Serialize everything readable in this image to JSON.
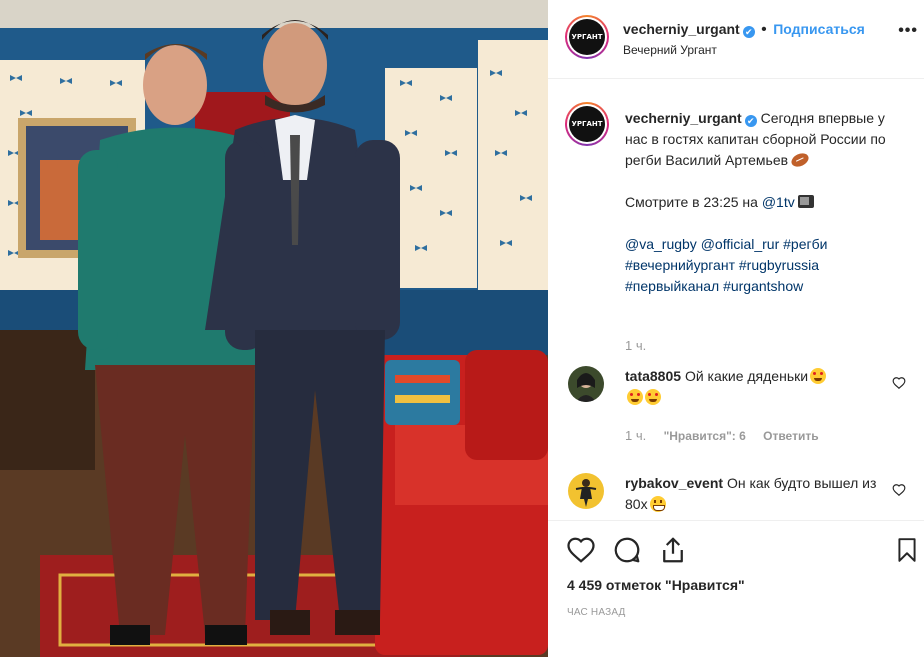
{
  "post": {
    "account": {
      "username": "vecherniy_urgant",
      "display_name": "Вечерний Ургант",
      "follow_label": "Подписаться",
      "avatar_text": "УРГАНТ",
      "verified_mark": "✔"
    },
    "caption": {
      "username": "vecherniy_urgant",
      "text": "Сегодня впервые у нас в гостях капитан сборной России по регби Василий Артемьев",
      "emoji_icon": "rugby-ball-icon",
      "watch_prefix": "Смотрите в 23:25 на ",
      "watch_mention": "@1tv",
      "watch_icon": "tv-icon",
      "tags": [
        "@va_rugby",
        "@official_rur",
        "#регби",
        "#вечернийургант",
        "#rugbyrussia",
        "#первыйканал",
        "#urgantshow"
      ],
      "time": "1 ч."
    },
    "comments": [
      {
        "username": "tata8805",
        "text": "Ой какие дяденьки",
        "emoji_icon": "star-struck-emoji",
        "time": "1 ч.",
        "likes": "\"Нравится\": 6",
        "reply": "Ответить"
      },
      {
        "username": "rybakov_event",
        "text": "Он как будто вышел из 80х",
        "emoji_icon": "grinning-emoji"
      }
    ],
    "likes_text": "4 459 отметок \"Нравится\"",
    "posted_ago": "ЧАС НАЗАД",
    "more_icon": "•••"
  },
  "colors": {
    "accent": "#3897f0",
    "mention": "#003569",
    "muted": "#999999",
    "wall_blue": "#1f5a8a",
    "wallpaper": "#f6ead4",
    "sofa_red": "#c8201e"
  }
}
